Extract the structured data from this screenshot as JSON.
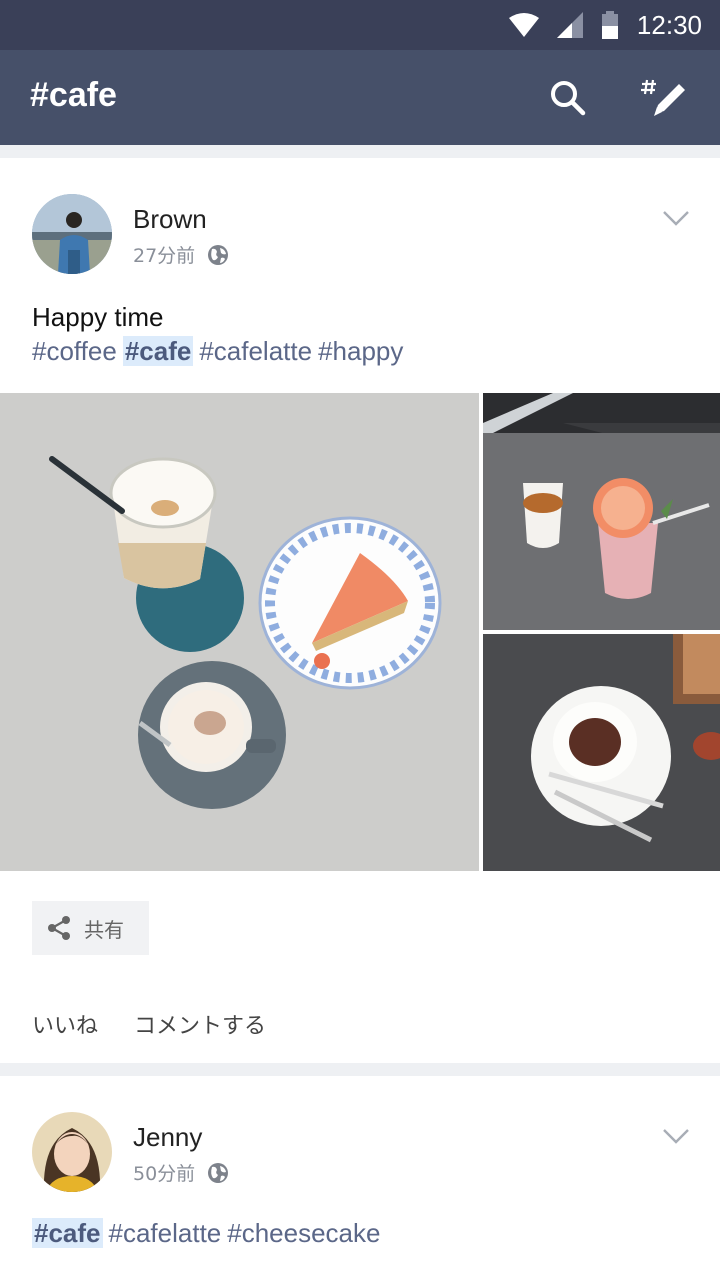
{
  "status_bar": {
    "time": "12:30"
  },
  "app_bar": {
    "title": "#cafe"
  },
  "posts": [
    {
      "user": "Brown",
      "time": "27分前",
      "text": "Happy time",
      "tags": [
        {
          "text": "#coffee",
          "highlight": false
        },
        {
          "text": "#cafe",
          "highlight": true
        },
        {
          "text": "#cafelatte",
          "highlight": false
        },
        {
          "text": "#happy",
          "highlight": false
        }
      ],
      "share_label": "共有",
      "like_label": "いいね",
      "comment_label": "コメントする"
    },
    {
      "user": "Jenny",
      "time": "50分前",
      "tags": [
        {
          "text": "#cafe",
          "highlight": true
        },
        {
          "text": "#cafelatte",
          "highlight": false
        },
        {
          "text": "#cheesecake",
          "highlight": false
        }
      ]
    }
  ],
  "icons": {
    "status": [
      "wifi-icon",
      "signal-icon",
      "battery-icon"
    ],
    "app_bar": [
      "search-icon",
      "hashtag-compose-icon"
    ],
    "post": [
      "globe-icon",
      "chevron-down-icon",
      "share-icon"
    ]
  },
  "colors": {
    "status_bar": "#3a4058",
    "app_bar": "#465069",
    "hashtag": "#5b6788",
    "hashtag_highlight_bg": "#dcebfb"
  }
}
